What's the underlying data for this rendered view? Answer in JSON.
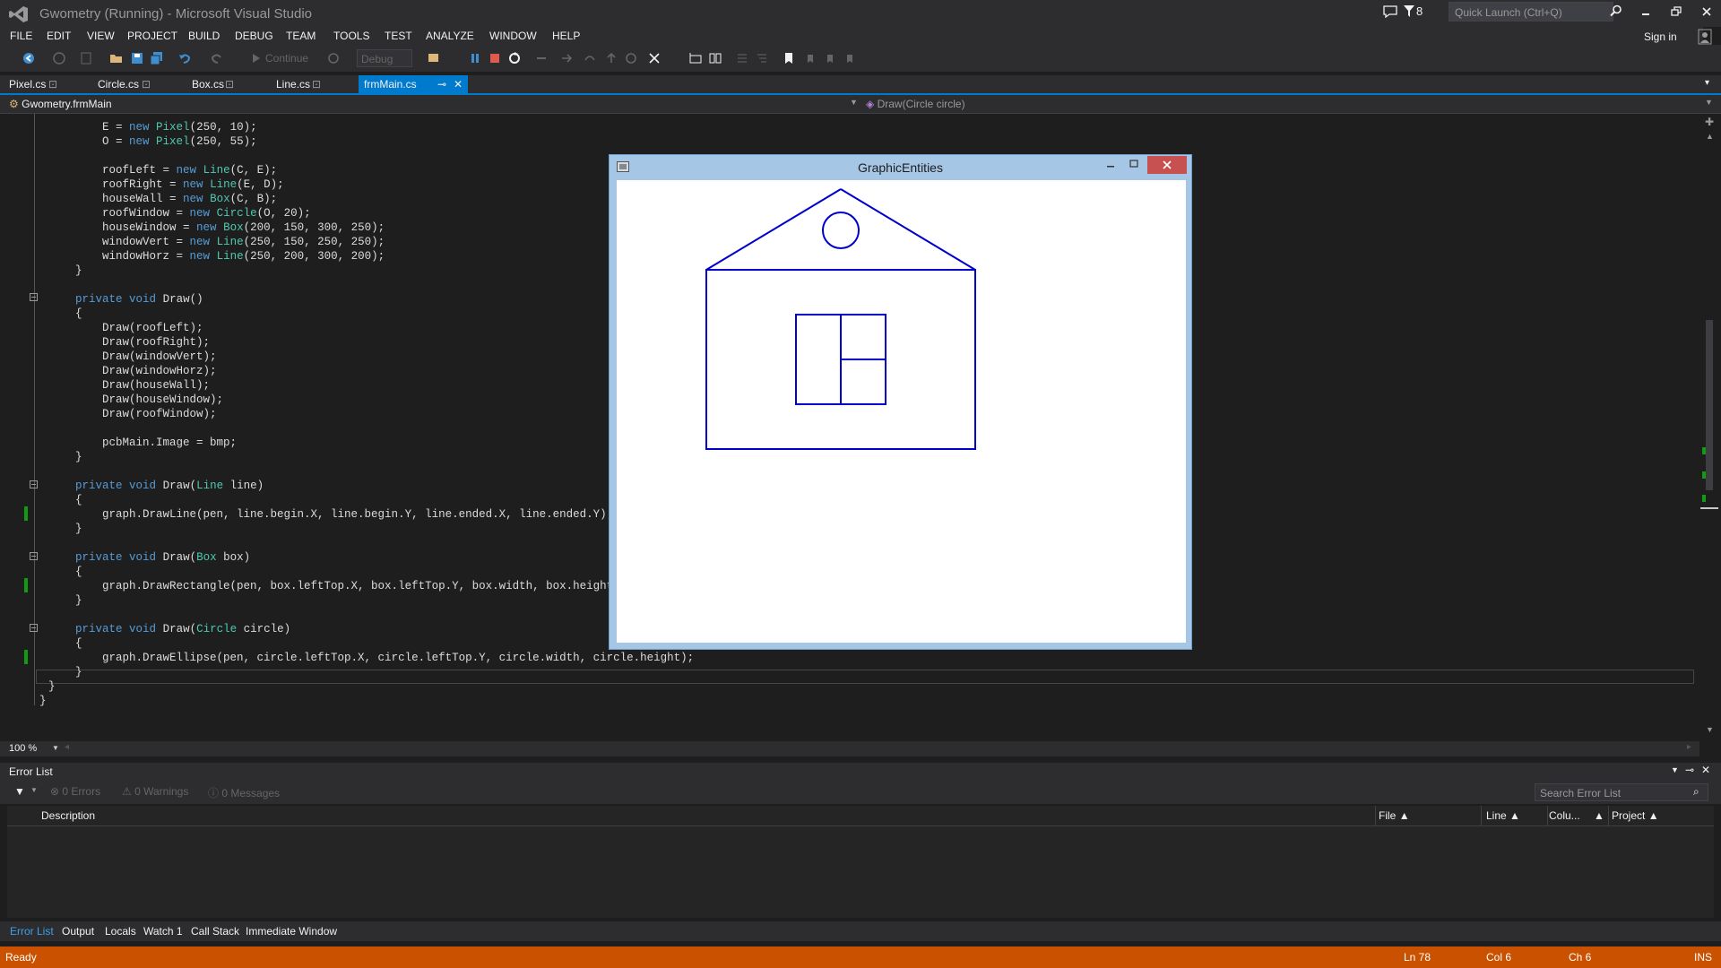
{
  "window": {
    "title": "Gwometry (Running) - Microsoft Visual Studio",
    "notification_count": "8",
    "quick_launch_placeholder": "Quick Launch (Ctrl+Q)",
    "sign_in": "Sign in"
  },
  "menu": [
    "FILE",
    "EDIT",
    "VIEW",
    "PROJECT",
    "BUILD",
    "DEBUG",
    "TEAM",
    "TOOLS",
    "TEST",
    "ANALYZE",
    "WINDOW",
    "HELP"
  ],
  "toolbar": {
    "continue_label": "Continue",
    "configuration": "Debug"
  },
  "tabs": [
    {
      "label": "Pixel.cs"
    },
    {
      "label": "Circle.cs"
    },
    {
      "label": "Box.cs"
    },
    {
      "label": "Line.cs"
    },
    {
      "label": "frmMain.cs",
      "active": true
    }
  ],
  "navbar": {
    "class_scope": "Gwometry.frmMain",
    "member_scope": "Draw(Circle circle)"
  },
  "code_lines": [
    "        E = new Pixel(250, 10);",
    "        O = new Pixel(250, 55);",
    "",
    "        roofLeft = new Line(C, E);",
    "        roofRight = new Line(E, D);",
    "        houseWall = new Box(C, B);",
    "        roofWindow = new Circle(O, 20);",
    "        houseWindow = new Box(200, 150, 300, 250);",
    "        windowVert = new Line(250, 150, 250, 250);",
    "        windowHorz = new Line(250, 200, 300, 200);",
    "    }",
    "",
    "    private void Draw()",
    "    {",
    "        Draw(roofLeft);",
    "        Draw(roofRight);",
    "        Draw(windowVert);",
    "        Draw(windowHorz);",
    "        Draw(houseWall);",
    "        Draw(houseWindow);",
    "        Draw(roofWindow);",
    "",
    "        pcbMain.Image = bmp;",
    "    }",
    "",
    "    private void Draw(Line line)",
    "    {",
    "        graph.DrawLine(pen, line.begin.X, line.begin.Y, line.ended.X, line.ended.Y);",
    "    }",
    "",
    "    private void Draw(Box box)",
    "    {",
    "        graph.DrawRectangle(pen, box.leftTop.X, box.leftTop.Y, box.width, box.height);",
    "    }",
    "",
    "    private void Draw(Circle circle)",
    "    {",
    "        graph.DrawEllipse(pen, circle.leftTop.X, circle.leftTop.Y, circle.width, circle.height);",
    "    }",
    "}",
    "}"
  ],
  "zoom": "100 %",
  "error_list": {
    "title": "Error List",
    "errors": "0 Errors",
    "warnings": "0 Warnings",
    "messages": "0 Messages",
    "search_placeholder": "Search Error List",
    "columns": [
      "Description",
      "File",
      "Line",
      "Colu...",
      "Project"
    ]
  },
  "bottom_tabs": [
    "Error List",
    "Output",
    "Locals",
    "Watch 1",
    "Call Stack",
    "Immediate Window"
  ],
  "status": {
    "state": "Ready",
    "line": "Ln 78",
    "col": "Col 6",
    "ch": "Ch 6",
    "mode": "INS"
  },
  "form": {
    "title": "GraphicEntities",
    "stroke_color": "#0000cc"
  },
  "colors": {
    "accent": "#007acc",
    "status_bar": "#ca5100",
    "keyword": "#569cd6",
    "type": "#4ec9b0"
  }
}
